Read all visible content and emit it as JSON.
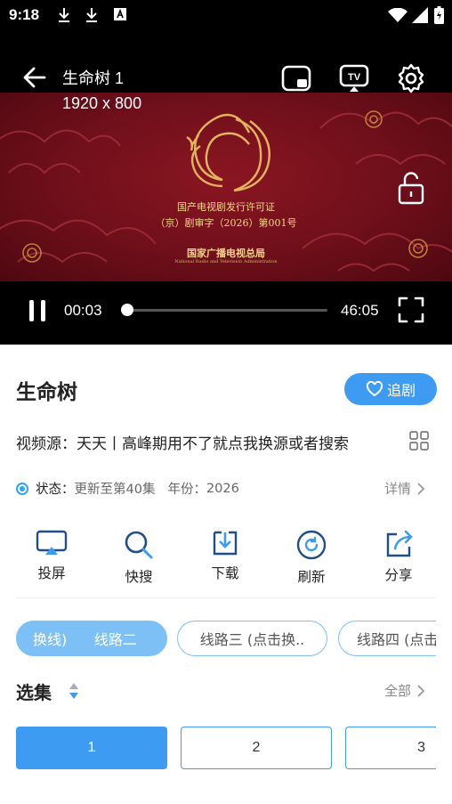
{
  "status_bar": {
    "time": "9:18"
  },
  "player": {
    "title": "生命树 1",
    "resolution": "1920 x 800",
    "current_time": "00:03",
    "total_time": "46:05",
    "progress": 0.001,
    "license_line1": "国产电视剧发行许可证",
    "license_line2": "（京）剧审字（2026）第001号",
    "agency_cn": "国家广播电视总局",
    "agency_en": "National Radio and Television Administration"
  },
  "show": {
    "title": "生命树",
    "follow_label": "追剧",
    "source_text": "视频源：天天丨高峰期用不了就点我换源或者搜索",
    "status_label": "状态：",
    "status_value": "更新至第40集",
    "year_label": "年份：",
    "year_value": "2026",
    "detail_label": "详情"
  },
  "actions": [
    {
      "label": "投屏",
      "icon": "cast-icon"
    },
    {
      "label": "快搜",
      "icon": "search-icon"
    },
    {
      "label": "下载",
      "icon": "download-icon"
    },
    {
      "label": "刷新",
      "icon": "refresh-icon"
    },
    {
      "label": "分享",
      "icon": "share-icon"
    }
  ],
  "lines": [
    {
      "label": "换线)      线路二",
      "active": true
    },
    {
      "label": "线路三 (点击换..",
      "active": false
    },
    {
      "label": "线路四 (点击",
      "active": false
    }
  ],
  "episodes": {
    "header": "选集",
    "all_label": "全部",
    "items": [
      "1",
      "2",
      "3"
    ]
  },
  "colors": {
    "accent": "#3d9cf2",
    "chip": "#7cc0f6",
    "video_bg": "#6e0f1a",
    "gold": "#f4d58a"
  }
}
